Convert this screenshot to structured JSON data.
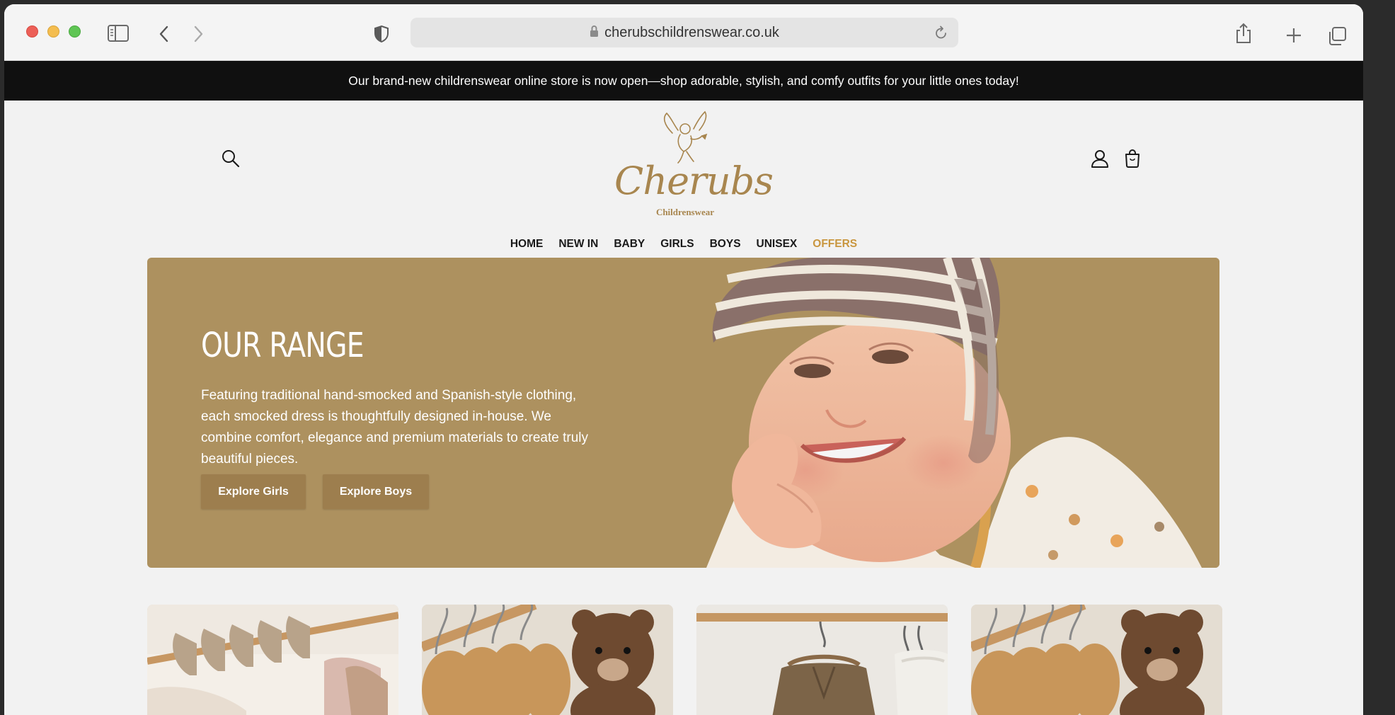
{
  "browser": {
    "url": "cherubschildrenswear.co.uk"
  },
  "announcement": {
    "text": "Our brand-new childrenswear online store is now open—shop adorable, stylish, and comfy outfits for your little ones today!"
  },
  "brand": {
    "name": "Cherubs",
    "tagline": "Childrenswear",
    "color": "#a8864f"
  },
  "nav": {
    "items": [
      {
        "label": "HOME"
      },
      {
        "label": "NEW IN"
      },
      {
        "label": "BABY"
      },
      {
        "label": "GIRLS"
      },
      {
        "label": "BOYS"
      },
      {
        "label": "UNISEX"
      },
      {
        "label": "OFFERS",
        "color": "#c9963f"
      }
    ]
  },
  "hero": {
    "title": "OUR RANGE",
    "text": "Featuring traditional hand-smocked and Spanish-style clothing, each smocked dress is thoughtfully designed in-house. We combine comfort, elegance and premium materials to create truly beautiful pieces.",
    "buttons": [
      {
        "label": "Explore Girls"
      },
      {
        "label": "Explore Boys"
      }
    ],
    "background": "#ad915f"
  },
  "icons": {
    "header": [
      "search-icon",
      "account-icon",
      "cart-icon"
    ],
    "chrome": [
      "sidebar-icon",
      "back-icon",
      "forward-icon",
      "shield-icon",
      "lock-icon",
      "reload-icon",
      "share-icon",
      "new-tab-icon",
      "tabs-overview-icon"
    ]
  }
}
